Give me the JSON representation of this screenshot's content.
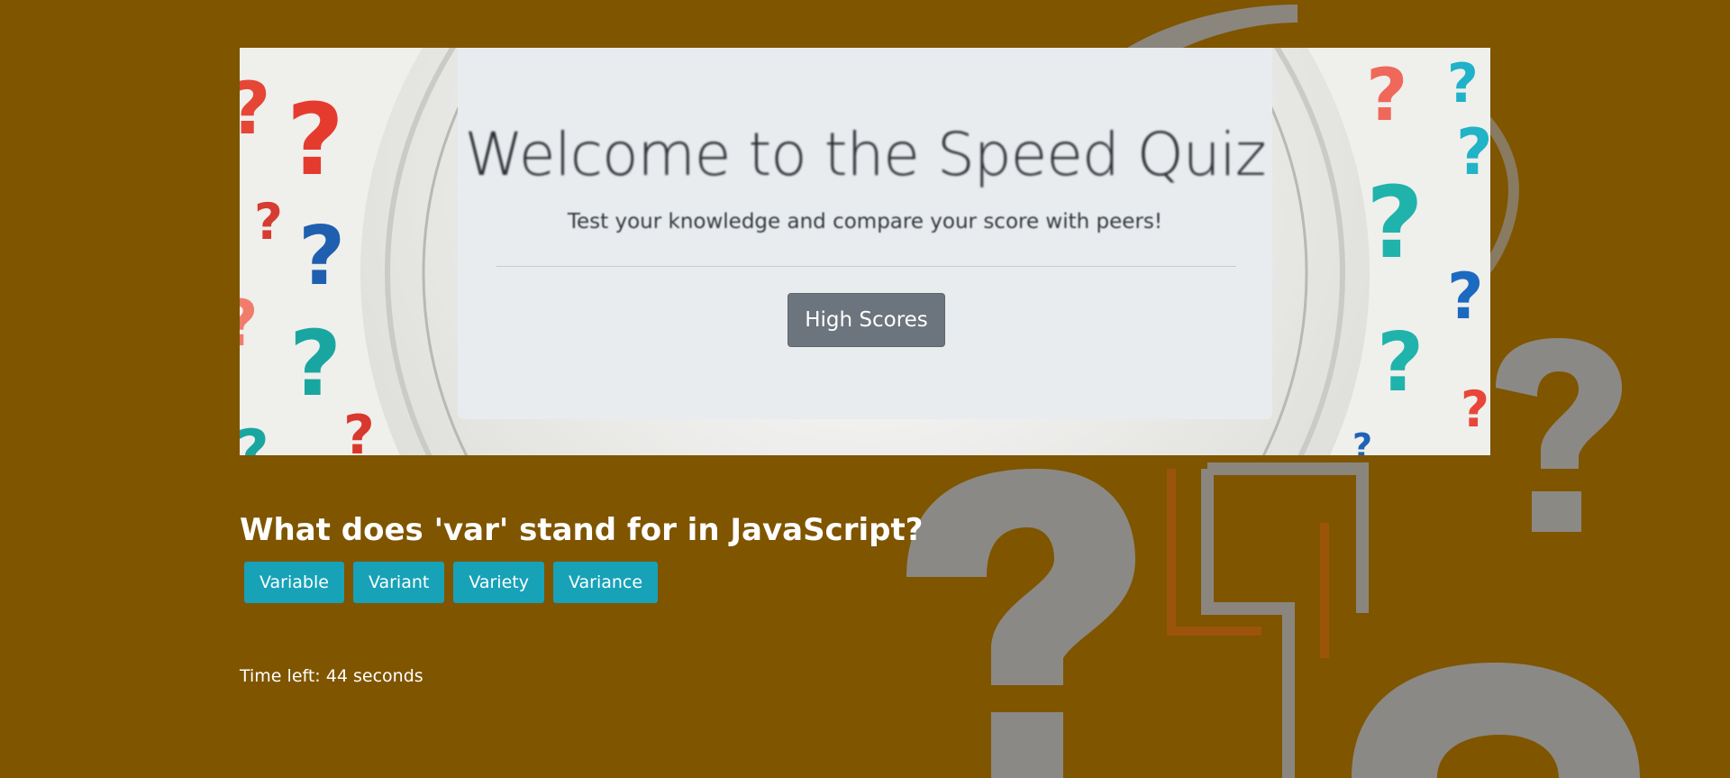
{
  "theme": {
    "page_background": "#7f5500",
    "jumbotron_background": "#e9ecef",
    "secondary_button": "#6c757d",
    "answer_button": "#17a2b8",
    "decor_grey": "#8c8c8c",
    "decor_red": "#e8463a",
    "decor_blue": "#1e63b5",
    "decor_teal": "#1fb3ab"
  },
  "hero": {
    "title": "Welcome to the Speed Quiz",
    "subtitle": "Test your knowledge and compare your score with peers!",
    "high_scores_label": "High Scores",
    "decor_icon": "question-mark-icon"
  },
  "quiz": {
    "question": "What does 'var' stand for in JavaScript?",
    "answers": [
      "Variable",
      "Variant",
      "Variety",
      "Variance"
    ],
    "timer_prefix": "Time left: ",
    "seconds_left": "44",
    "timer_suffix": " seconds"
  },
  "background": {
    "decor_icon": "question-mark-icon"
  }
}
